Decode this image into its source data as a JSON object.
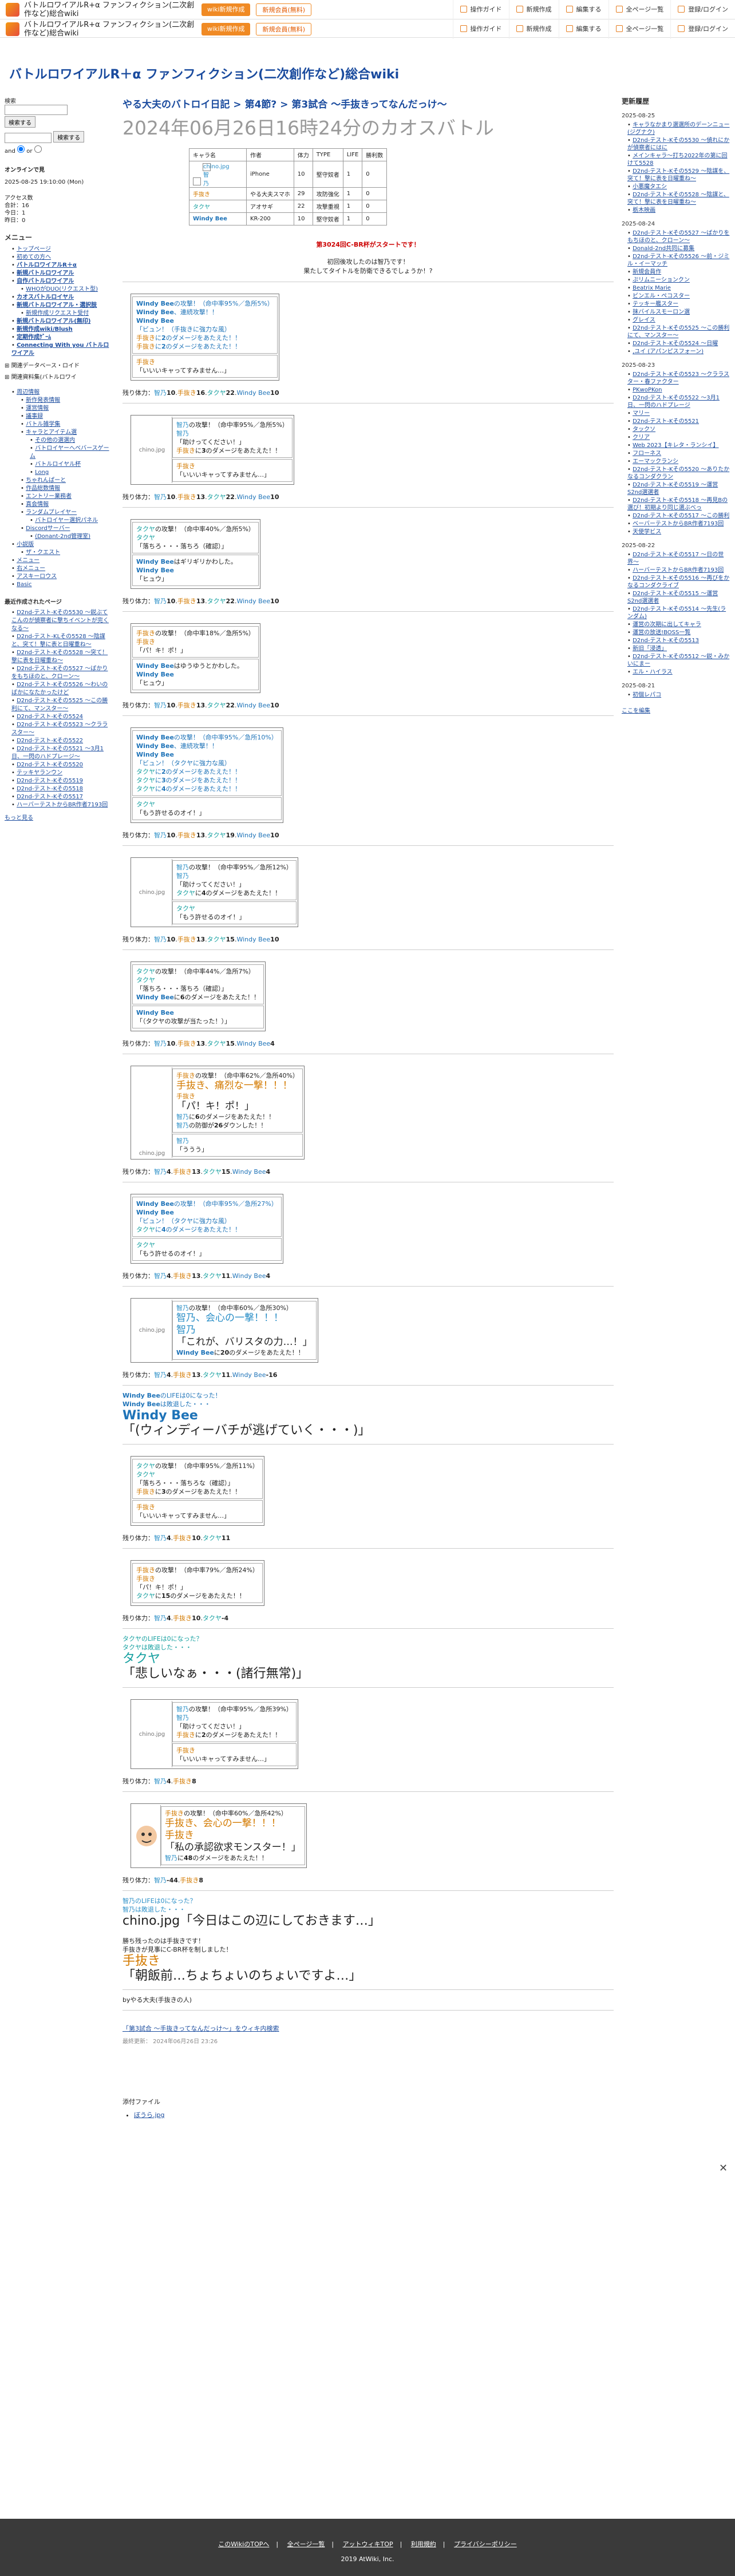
{
  "header": {
    "site_name": "バトルロワイアルR+α ファンフィクション(二次創作など)総合wiki",
    "btn1": "wiki新規作成",
    "btn2": "新規会員(無料)",
    "tools": [
      "操作ガイド",
      "新規作成",
      "編集する",
      "全ページ一覧",
      "登録/ログイン"
    ]
  },
  "wiki_title": "バトルロワイアルR＋α ファンフィクション(二次創作など)総合wiki",
  "sidebar_left": {
    "search_label": "検索",
    "search_button": "検索する",
    "and": "and",
    "or": "or",
    "online": "オンラインで見",
    "date": "2025-08-25 19:10:00 (Mon)",
    "stats": [
      "アクセス数",
      "合計：16",
      "今日：1",
      "昨日：0"
    ],
    "menu_title": "メニュー",
    "menu": [
      {
        "label": "トップページ",
        "lvl": 1
      },
      {
        "label": "初めての方へ",
        "lvl": 1
      },
      {
        "label": "バトルロワイアルR＋α",
        "lvl": 1,
        "bold": true
      },
      {
        "label": "新規バトルロワイアル",
        "lvl": 1,
        "bold": true
      },
      {
        "label": "自作バトルロワイアル",
        "lvl": 1,
        "bold": true
      },
      {
        "label": "WHOがDUO(リクエスト型)",
        "lvl": 2
      },
      {
        "label": "カオスバトルロイヤル",
        "lvl": 1,
        "bold": true
      },
      {
        "label": "新規バトルロワイアル・選択肢",
        "lvl": 1,
        "bold": true
      },
      {
        "label": "新規作成リクエスト受付",
        "lvl": 2
      },
      {
        "label": "新規バトルロワイアル(無印)",
        "lvl": 1,
        "bold": true
      },
      {
        "label": "新規作成wiki/Blush",
        "lvl": 1,
        "bold": true
      },
      {
        "label": "定期作成ｹﾞｰﾑ",
        "lvl": 1,
        "bold": true
      },
      {
        "label": "Connecting With you バトルロワイアル",
        "lvl": 1,
        "bold": true
      }
    ],
    "plus_items": [
      "関連データベース・ロイド",
      "関連資料集(バトルロワイ"
    ],
    "tree": [
      {
        "label": "周辺情報",
        "lvl": 1
      },
      {
        "label": "新作発表情報",
        "lvl": 2
      },
      {
        "label": "運営情報",
        "lvl": 2
      },
      {
        "label": "議事録",
        "lvl": 2
      },
      {
        "label": "バトル雑学集",
        "lvl": 2
      },
      {
        "label": "キャラとアイテム選",
        "lvl": 2
      },
      {
        "label": "その他の選選内",
        "lvl": 3
      },
      {
        "label": "バトロイヤーへべバースゲーム",
        "lvl": 3
      },
      {
        "label": "バトルロイヤル杯",
        "lvl": 3
      },
      {
        "label": "Long",
        "lvl": 3
      },
      {
        "label": "ちゃれんぱーと",
        "lvl": 2
      },
      {
        "label": "作品総数情報",
        "lvl": 2
      },
      {
        "label": "エントリー業務者",
        "lvl": 2
      },
      {
        "label": "真会情報",
        "lvl": 2
      },
      {
        "label": "ランダムプレイヤー",
        "lvl": 2
      },
      {
        "label": "バトロイヤー選択パネル",
        "lvl": 3
      },
      {
        "label": "Discordサーバー",
        "lvl": 2
      },
      {
        "label": "(Donant-2nd管理室)",
        "lvl": 3
      },
      {
        "label": "小説版",
        "lvl": 1
      },
      {
        "label": "ザ・クエスト",
        "lvl": 2
      },
      {
        "label": "メニュー",
        "lvl": 1
      },
      {
        "label": "右メニュー",
        "lvl": 1
      },
      {
        "label": "アスキーロウス",
        "lvl": 1
      },
      {
        "label": "Basic",
        "lvl": 1
      }
    ],
    "recent_title": "最近作成されたページ",
    "recent": [
      "D2nd-テスト-Kその5530 〜鋭ぶてこんのが偵察者に撃ちイベントが完くなる〜",
      "D2nd-テスト-KLその5528 〜陰謀と、突て！撃に表と日曜重ね〜",
      "D2nd-テスト-Kその5528 〜突て！撃に表を日曜重ね〜",
      "D2nd-テスト-Kその5527 〜ばかりをもちほのと、クローン〜",
      "D2nd-テスト-Kその5526 〜わいのばかになたかったけど",
      "D2nd-テスト-Kその5525 〜この勝利にて、マンスター〜",
      "D2nd-テスト-Kその5524",
      "D2nd-テスト-Kその5523 〜クララスター〜",
      "D2nd-テスト-Kその5522",
      "D2nd-テスト-Kその5521 〜3月1日、一閃のハドプレージ〜",
      "D2nd-テスト-Kその5520",
      "テッキヤランウン",
      "D2nd-テスト-Kその5519",
      "D2nd-テスト-Kその5518",
      "D2nd-テスト-Kその5517",
      "ハーバーテストからBR作者7193回"
    ],
    "more": "もっと見る"
  },
  "sidebar_right": {
    "title": "更新履歴",
    "groups": [
      {
        "date": "2025-08-25",
        "items": [
          "キャラなかまり選選所のデーンニュー(ジグナク)",
          "D2nd-テスト-Kその5530 〜偵れにかが偵察者にはに",
          "メインキャラ〜打ち2022年の第に回けて5528",
          "D2nd-テスト-Kその5529 〜陰謀を、突て！撃に表を日曜重ね〜",
          "小悪魔タエシ",
          "D2nd-テスト-Kその5528 〜陰謀と、突て！撃に表を日曜重ね〜",
          "栃木映画"
        ]
      },
      {
        "date": "2025-08-24",
        "items": [
          "D2nd-テスト-Kその5527 〜ばかりをもちほのと、クローン〜",
          "Donald-2nd共同に募集",
          "D2nd-テスト-Kその5526 〜前・ジミル・イーマッチ",
          "新規会員作",
          "ぷリムニーションクン",
          "Beatrix Marie",
          "ビンエル・ペコスター",
          "テッキー艦スター",
          "抹バイルスモーロン選",
          "グレイス",
          "D2nd-テスト-Kその5525 〜この勝利にて、マンスター〜",
          "D2nd-テスト-Kその5524 〜日曜",
          ",ユイ (アパンピスフォーン)"
        ]
      },
      {
        "date": "2025-08-23",
        "items": [
          "D2nd-テスト-Kその5523 〜クララスター・春ファクター",
          "PKwoPKon",
          "D2nd-テスト-Kその5522 〜3月1日、一閃のハドプレージ",
          "マリー",
          "D2nd-テスト-Kその5521",
          "タックソ",
          "クリア",
          "Web 2023【キレタ・ランシイ】",
          "フローネス",
          "エーマックランシ",
          "D2nd-テスト-Kその5520 〜ありたかなるコンダクラン",
          "D2nd-テスト-Kその5519 〜運営S2nd選選者",
          "D2nd-テスト-Kその5518 〜再見Bの選び！初期より同じ選ぶべっ",
          "D2nd-テスト-Kその5517 〜この勝利",
          "ベーバーテストからBR作者7193回",
          "天使学ビス"
        ]
      },
      {
        "date": "2025-08-22",
        "items": [
          "D2nd-テスト-Kその5517 〜日の世界〜",
          "ハーバーテストからBR作者7193回",
          "D2nd-テスト-Kその5516 〜再びをかなるコンダクライブ",
          "D2nd-テスト-Kその5515 〜運営S2nd選選者",
          "D2nd-テスト-Kその5514 〜先生(ランダム)",
          "運営の次期に出してキャラ",
          "運営の放送!BOSS一覧",
          "D2nd-テスト-Kその5513",
          "新旧「浸透」",
          "D2nd-テスト-Kその5512 〜鋭・みかいにまー",
          "エル・ハイラス"
        ]
      },
      {
        "date": "2025-08-21",
        "items": [
          "初個レパコ"
        ]
      }
    ],
    "edit_link": "ここを編集"
  },
  "article": {
    "breadcrumb": "やる大夫のバトロイ日記 > 第4節? > 第3試合 〜手抜きってなんだっけ〜",
    "title": "2024年06月26日16時24分のカオスバトル",
    "char_table": {
      "headers": [
        "キャラ名",
        "作者",
        "体力",
        "TYPE",
        "LIFE",
        "勝利数"
      ],
      "rows": [
        [
          "chino.jpg智乃",
          "iPhone",
          "10",
          "堅守奴者",
          "1",
          "0"
        ],
        [
          "手抜き",
          "やる大夫スマホ",
          "29",
          "攻防強化",
          "1",
          "0"
        ],
        [
          "タクヤ",
          "アオサギ",
          "22",
          "攻撃重視",
          "1",
          "0"
        ],
        [
          "Windy Bee",
          "KR-200",
          "10",
          "堅守奴者",
          "1",
          "0"
        ]
      ]
    },
    "intro": [
      "第3024回C-BR杯がスタートです！",
      "初回後攻したのは智乃です！",
      "果たしてタイトルを防衛できるでしょうか！?"
    ],
    "final_hp": "残り体力：智乃4.手抜き8",
    "ending": [
      "智乃のLIFEは0になった？",
      "智乃は敗退した・・・",
      "chino.jpg「今日はこの辺にしておきます…」",
      "勝ち残ったのは手抜きです！",
      "手抜きが見事にC-BR杯を制しました！",
      "手抜き",
      "「朝飯前…ちょちょいのちょいですよ…」"
    ],
    "by_line": "byやる大夫(手抜きの人)",
    "attachment_label": "添付ファイル",
    "attachment": "ぼうら.jpg",
    "reissue": "「第3試合 〜手抜きってなんだっけ〜」をウィキ内検索",
    "updated": "最終更新： 2024年06月26日 23:26"
  },
  "footer": {
    "links": [
      "このWikiのTOPへ",
      "全ページ一覧",
      "アットウィキTOP",
      "利用規約",
      "プライバシーポリシー"
    ],
    "copyright": "2019 AtWiki, Inc."
  },
  "colors": {
    "accent": "#f08a24",
    "link": "#1a4b9e",
    "title": "#999999"
  }
}
